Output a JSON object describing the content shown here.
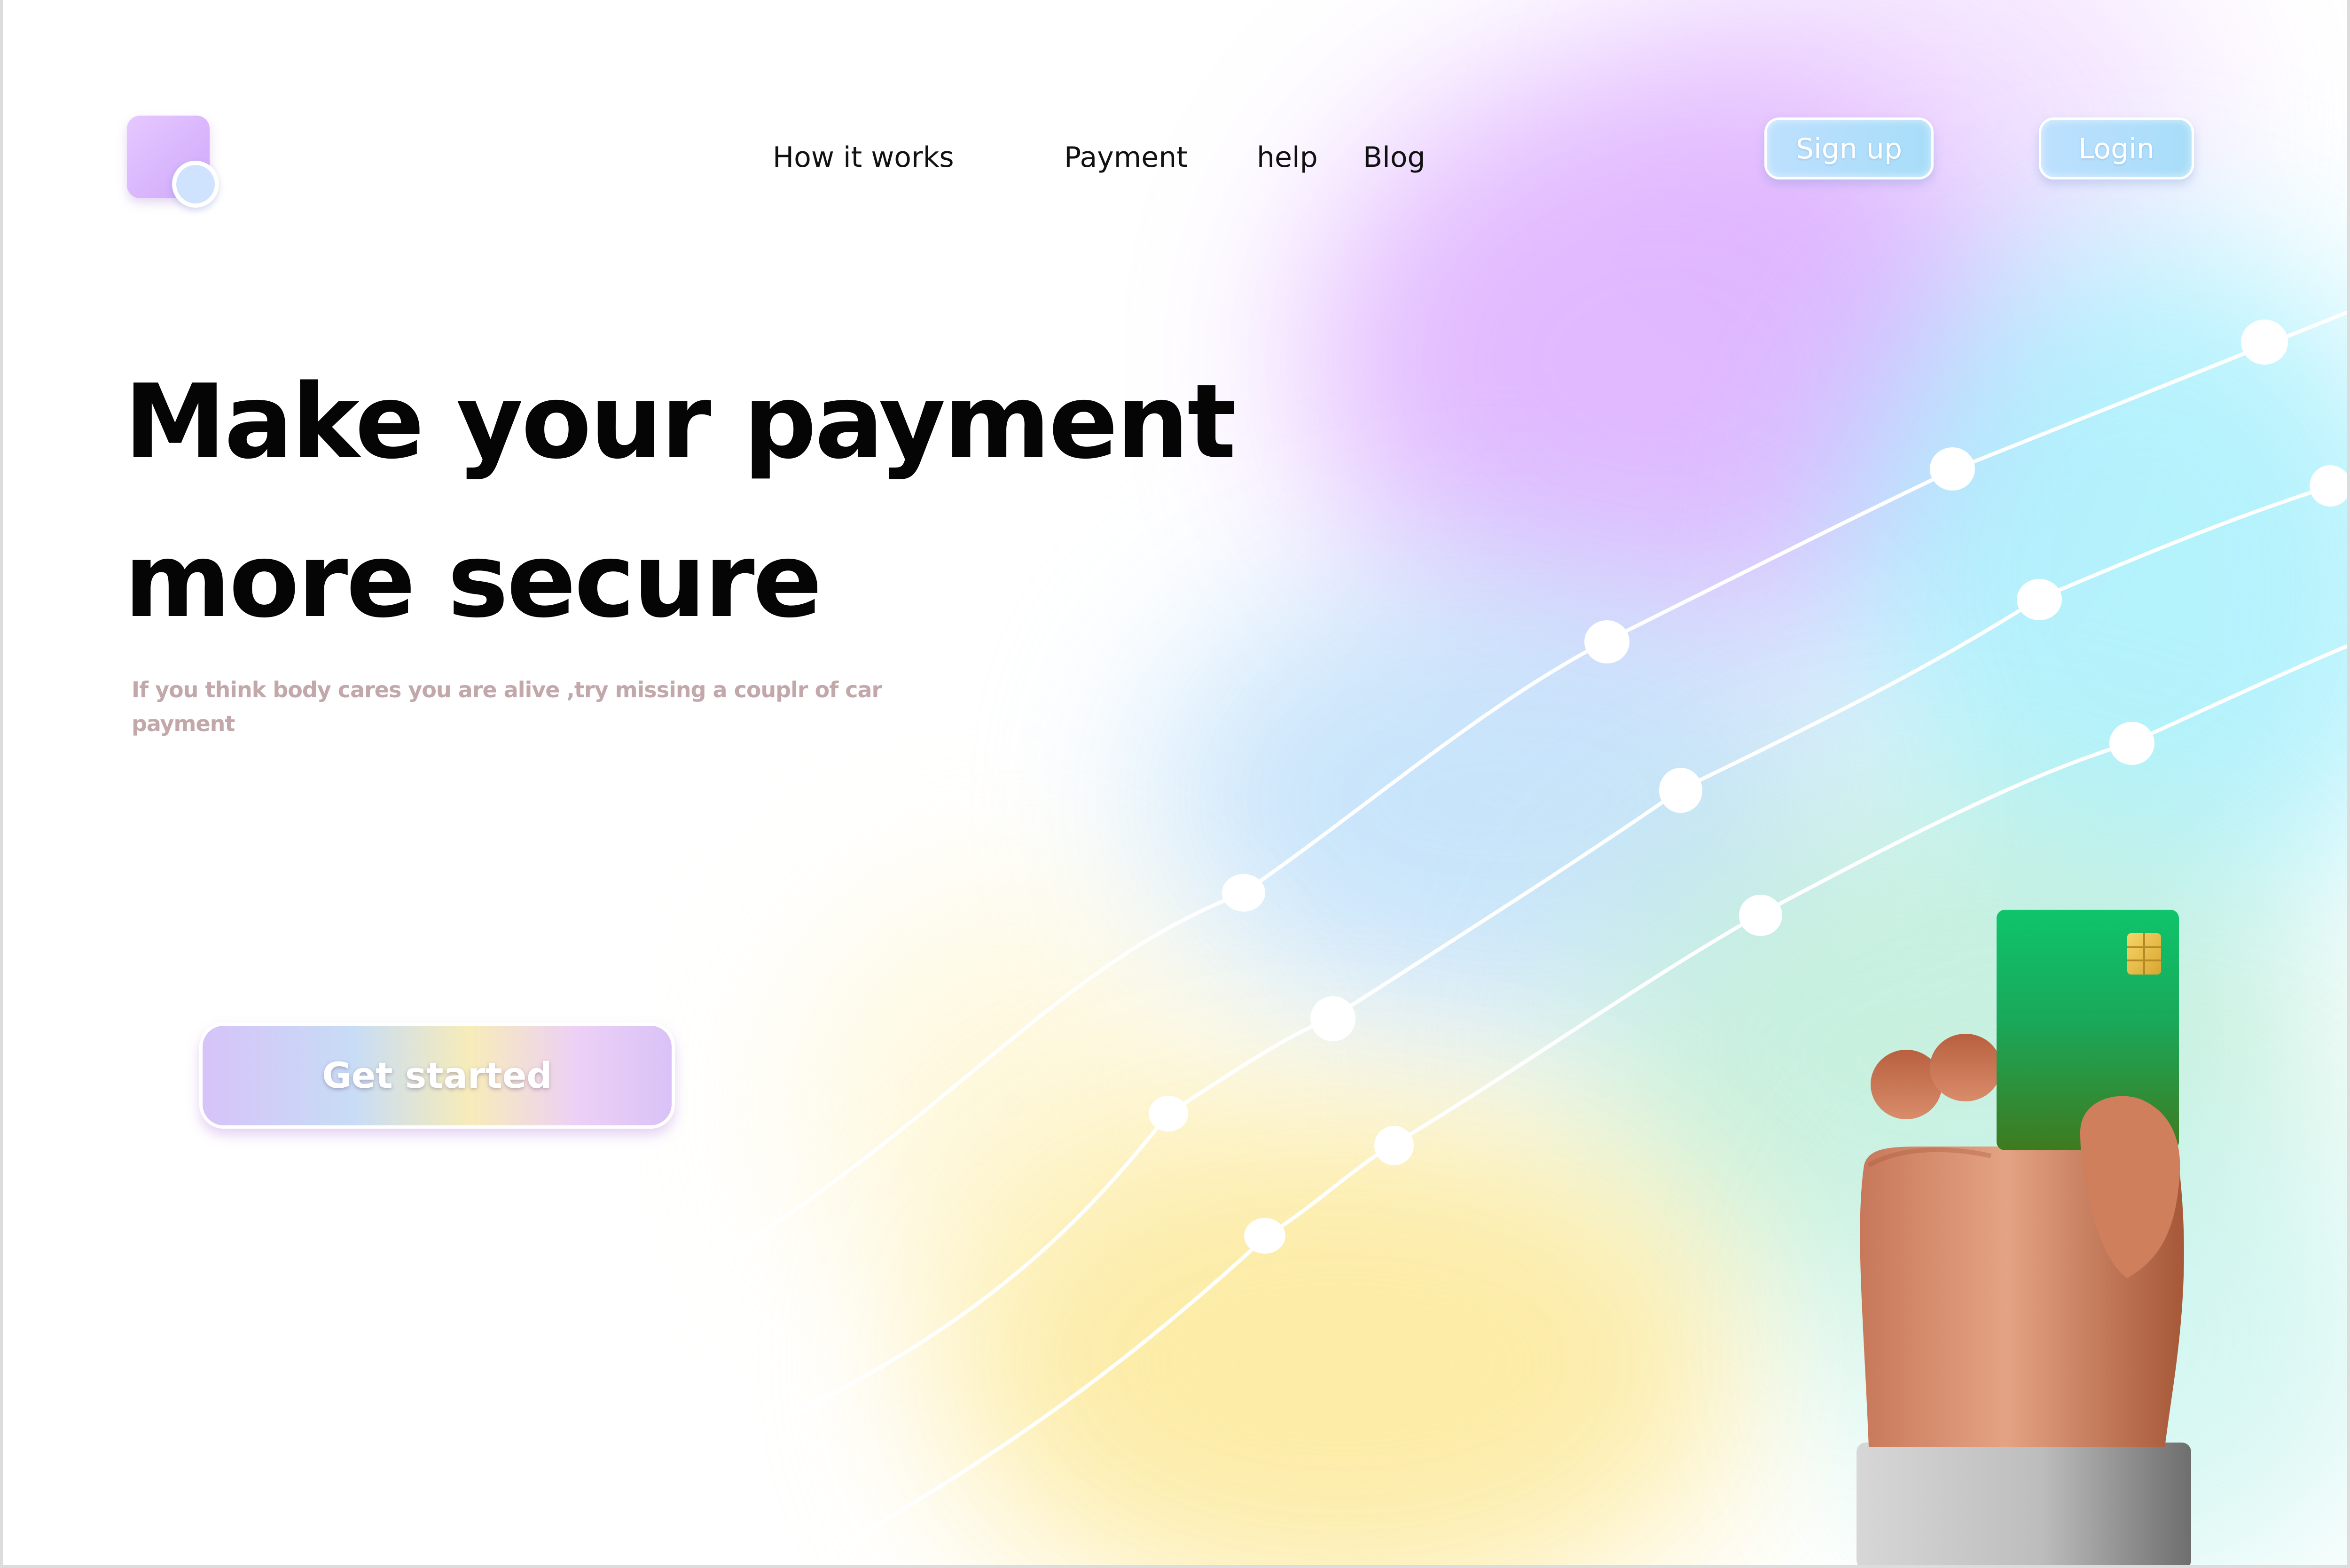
{
  "nav": {
    "links": [
      "How it works",
      "Payment",
      "help",
      "Blog"
    ],
    "signup_label": "Sign up",
    "login_label": "Login"
  },
  "hero": {
    "title_line1": "Make your payment",
    "title_line2": "more secure",
    "subtitle": "If you think body cares you are alive ,try missing a couplr of car payment",
    "cta_label": "Get started"
  },
  "icons": {
    "logo": "app-logo",
    "card_chip": "card-chip-icon"
  },
  "colors": {
    "accent_purple": "#d9a6ff",
    "accent_cyan": "#9ceefc",
    "accent_yellow": "#fcea9e",
    "card_green": "#10c46a",
    "text_dark": "#050505",
    "subtitle": "#c2a8aa"
  }
}
